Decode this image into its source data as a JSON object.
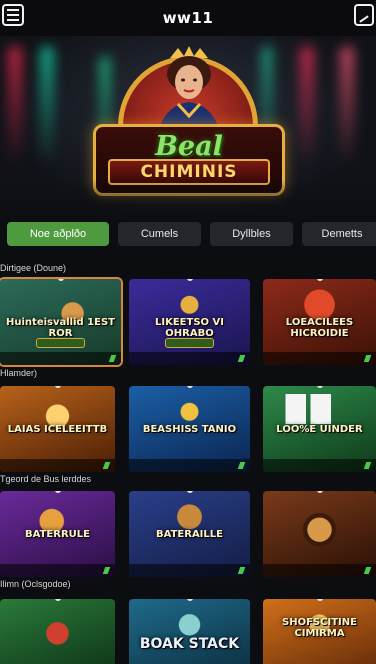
{
  "header": {
    "brand": "ww11",
    "menu_icon": "hamburger-menu-icon",
    "corner_icon": "edit-icon"
  },
  "hero": {
    "logo_line1": "Beal",
    "logo_line2": "CHIMINIS"
  },
  "tabs": [
    {
      "label": "Noe aðplðo",
      "active": true
    },
    {
      "label": "Cumels",
      "active": false
    },
    {
      "label": "Dyllbles",
      "active": false
    },
    {
      "label": "Demetts",
      "active": false
    }
  ],
  "sections": [
    {
      "label": "Dirtigee (Doune)",
      "cards": [
        {
          "title": "Huinteisvallid 1EST ROR",
          "colors": [
            "#2c6b5a",
            "#173a2a"
          ],
          "selected": true
        },
        {
          "title": "LIKEETSO VI OHRABO",
          "colors": [
            "#3a2c9a",
            "#1a1550"
          ],
          "selected": false
        },
        {
          "title": "LOEACILEES HICROIDIE",
          "colors": [
            "#8e2a1a",
            "#3a1206"
          ],
          "selected": false
        }
      ]
    },
    {
      "label": "Hlamder)",
      "cards": [
        {
          "title": "LAIAS ICELEEITTB",
          "colors": [
            "#b8621a",
            "#4a1e06"
          ],
          "selected": false
        },
        {
          "title": "BEASHISS TANIO",
          "colors": [
            "#1b5fa6",
            "#0b2550"
          ],
          "selected": false
        },
        {
          "title": "LOO%E UINDER",
          "colors": [
            "#2d8a4a",
            "#0f3a1a"
          ],
          "selected": false
        }
      ]
    },
    {
      "label": "Tgeord de Bus lerddes",
      "cards": [
        {
          "title": "BATERRULE",
          "colors": [
            "#6a2a9a",
            "#2a0f45"
          ],
          "selected": false
        },
        {
          "title": "BATERAILLE",
          "colors": [
            "#2a3f8a",
            "#141d45"
          ],
          "selected": false
        },
        {
          "title": "",
          "colors": [
            "#7a3a1a",
            "#2a1006"
          ],
          "selected": false
        }
      ]
    },
    {
      "label": "Ilimn (Oclsgodoe)",
      "cards": [
        {
          "title": "",
          "colors": [
            "#2a7a3a",
            "#0c2e14"
          ],
          "selected": false
        },
        {
          "title": "BOAK STACK",
          "colors": [
            "#1f6a8a",
            "#0a2a3a"
          ],
          "selected": false
        },
        {
          "title": "SHOFSCITINE CIMIRMA",
          "colors": [
            "#d0701a",
            "#5a2406"
          ],
          "selected": false
        }
      ]
    }
  ]
}
